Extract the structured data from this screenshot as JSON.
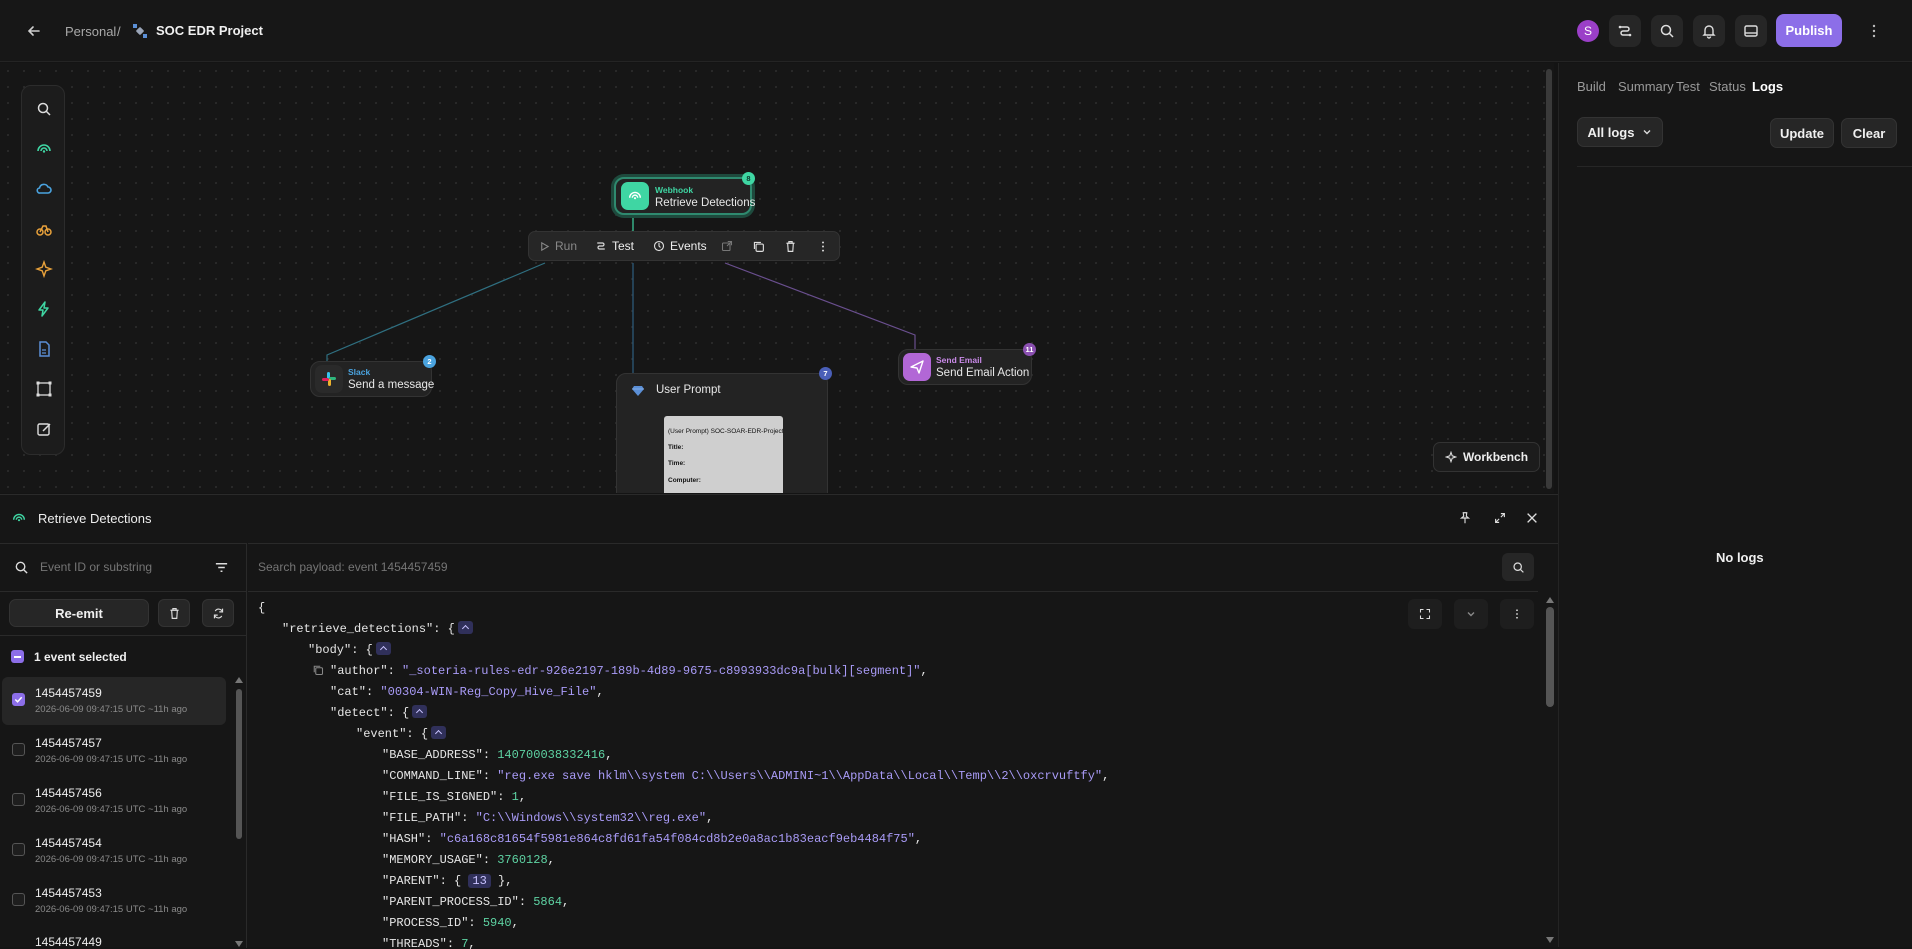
{
  "header": {
    "breadcrumb_workspace": "Personal",
    "breadcrumb_separator": "/",
    "project_name": "SOC EDR Project",
    "avatar_letter": "S",
    "publish_label": "Publish"
  },
  "canvas": {
    "nodes": {
      "webhook": {
        "type": "Webhook",
        "title": "Retrieve Detections",
        "badge": "8"
      },
      "slack": {
        "type": "Slack",
        "title": "Send a message",
        "badge": "2"
      },
      "email": {
        "type": "Send Email",
        "title": "Send Email Action",
        "badge": "11"
      },
      "prompt": {
        "title": "User Prompt",
        "badge": "7",
        "preview_heading": "(User Prompt) SOC-SOAR-EDR-Project",
        "preview_title": "Title:",
        "preview_time": "Time:",
        "preview_computer": "Computer:"
      }
    },
    "node_toolbar": {
      "run": "Run",
      "test": "Test",
      "events": "Events"
    },
    "workbench_label": "Workbench"
  },
  "right_panel": {
    "tabs": [
      "Build",
      "Summary",
      "Test",
      "Status",
      "Logs"
    ],
    "active_tab": "Logs",
    "filter_label": "All logs",
    "update_label": "Update",
    "clear_label": "Clear",
    "empty_text": "No logs"
  },
  "bottom_panel": {
    "title": "Retrieve Detections",
    "event_search_placeholder": "Event ID or substring",
    "payload_search_placeholder": "Search payload: event 1454457459",
    "reemit_label": "Re-emit",
    "selected_text": "1 event selected",
    "events": [
      {
        "id": "1454457459",
        "time": "2026-06-09 09:47:15 UTC ~11h ago",
        "checked": true
      },
      {
        "id": "1454457457",
        "time": "2026-06-09 09:47:15 UTC ~11h ago",
        "checked": false
      },
      {
        "id": "1454457456",
        "time": "2026-06-09 09:47:15 UTC ~11h ago",
        "checked": false
      },
      {
        "id": "1454457454",
        "time": "2026-06-09 09:47:15 UTC ~11h ago",
        "checked": false
      },
      {
        "id": "1454457453",
        "time": "2026-06-09 09:47:15 UTC ~11h ago",
        "checked": false
      },
      {
        "id": "1454457449",
        "time": "",
        "checked": false
      }
    ],
    "payload": {
      "root_key": "\"retrieve_detections\"",
      "body_key": "\"body\"",
      "author_key": "\"author\"",
      "author_val": "\"_soteria-rules-edr-926e2197-189b-4d89-9675-c8993933dc9a[bulk][segment]\"",
      "cat_key": "\"cat\"",
      "cat_val": "\"00304-WIN-Reg_Copy_Hive_File\"",
      "detect_key": "\"detect\"",
      "event_key": "\"event\"",
      "base_key": "\"BASE_ADDRESS\"",
      "base_val": "140700038332416",
      "cmd_key": "\"COMMAND_LINE\"",
      "cmd_val": "\"reg.exe save hklm\\\\system C:\\\\Users\\\\ADMINI~1\\\\AppData\\\\Local\\\\Temp\\\\2\\\\oxcrvuftfy\"",
      "signed_key": "\"FILE_IS_SIGNED\"",
      "signed_val": "1",
      "path_key": "\"FILE_PATH\"",
      "path_val": "\"C:\\\\Windows\\\\system32\\\\reg.exe\"",
      "hash_key": "\"HASH\"",
      "hash_val": "\"c6a168c81654f5981e864c8fd61fa54f084cd8b2e0a8ac1b83eacf9eb4484f75\"",
      "mem_key": "\"MEMORY_USAGE\"",
      "mem_val": "3760128",
      "parent_key": "\"PARENT\"",
      "parent_count": "13",
      "ppid_key": "\"PARENT_PROCESS_ID\"",
      "ppid_val": "5864",
      "pid_key": "\"PROCESS_ID\"",
      "pid_val": "5940",
      "threads_key": "\"THREADS\"",
      "threads_val": "7"
    }
  },
  "colors": {
    "accent": "#8c6ee8",
    "webhook": "#3fd6a3",
    "slack": "#4aa3df",
    "email": "#b267d6",
    "string": "#a99bf7",
    "number": "#5ed3a3"
  }
}
